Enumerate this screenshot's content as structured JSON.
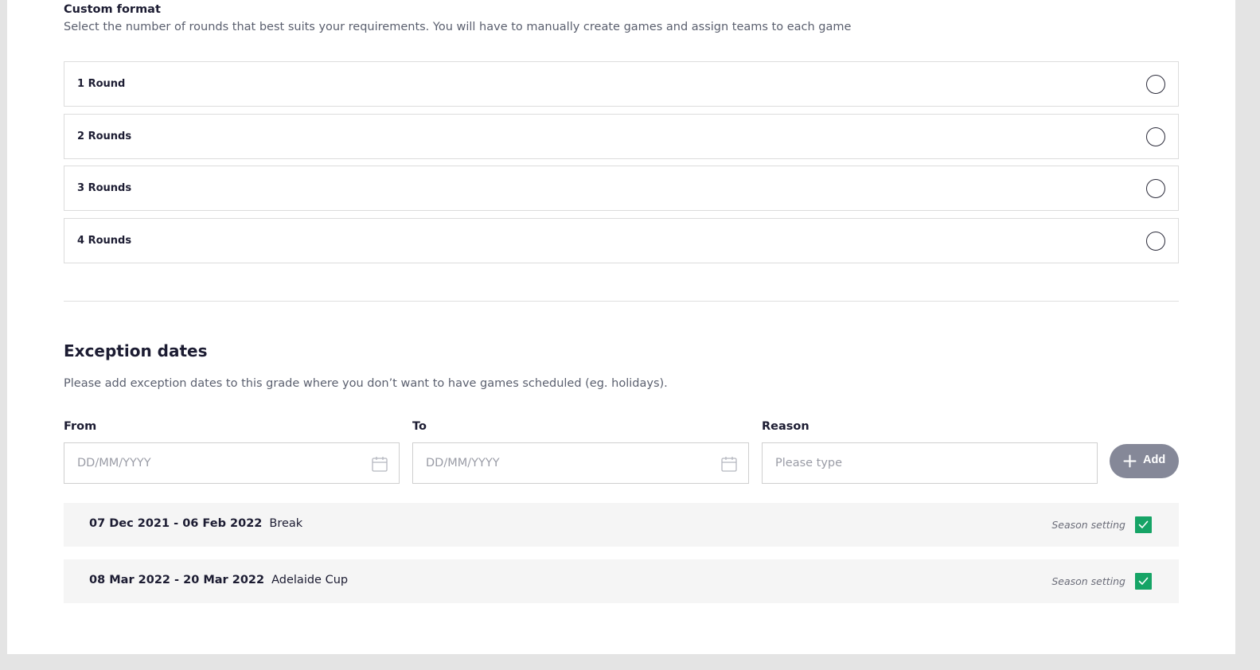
{
  "custom_format": {
    "title": "Custom format",
    "description": "Select the number of rounds that best suits your requirements. You will have to manually create games and assign teams to each game",
    "options": [
      {
        "label": "1 Round",
        "selected": false
      },
      {
        "label": "2 Rounds",
        "selected": false
      },
      {
        "label": "3 Rounds",
        "selected": false
      },
      {
        "label": "4 Rounds",
        "selected": false
      }
    ]
  },
  "exception_dates": {
    "title": "Exception dates",
    "description": "Please add exception dates to this grade where you don’t want to have games scheduled (eg. holidays).",
    "from": {
      "label": "From",
      "placeholder": "DD/MM/YYYY",
      "icon": "calendar-icon"
    },
    "to": {
      "label": "To",
      "placeholder": "DD/MM/YYYY",
      "icon": "calendar-icon"
    },
    "reason": {
      "label": "Reason",
      "placeholder": "Please type"
    },
    "add_button": {
      "label": "Add",
      "icon": "plus-icon",
      "color": "#858898"
    },
    "entries": [
      {
        "range": "07 Dec 2021 - 06 Feb 2022",
        "reason": "Break",
        "season_label": "Season setting",
        "checked": true
      },
      {
        "range": "08 Mar 2022 - 20 Mar 2022",
        "reason": "Adelaide Cup",
        "season_label": "Season setting",
        "checked": true
      }
    ],
    "check_color": "#16a466"
  }
}
